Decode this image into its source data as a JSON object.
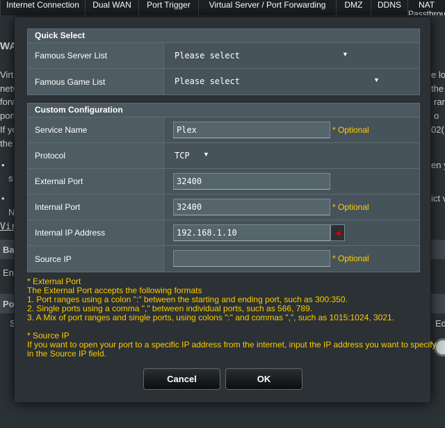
{
  "background": {
    "tabs": [
      "Internet Connection",
      "Dual WAN",
      "Port Trigger",
      "Virtual Server / Port Forwarding",
      "DMZ",
      "DDNS",
      "NAT Passthrough"
    ],
    "fragments": {
      "wa": "WA",
      "virt": "Virt",
      "netw": "netw",
      "forw": "forw",
      "port": "port",
      "if_you": "If yo",
      "the": "the",
      "bullet1": "•",
      "s1": "s",
      "bullet2": "•",
      "n1": "N",
      "vir": "Vir",
      "ba": "Ba",
      "en": "En",
      "po": "Po",
      "s2": "S",
      "r_lo": "e lo",
      "r_the": "the p",
      "r_rar": "rar",
      "r_o": "o",
      "r_02": "02(",
      "r_en": "en y",
      "r_ict": "ict v",
      "r_ed": "Ed"
    }
  },
  "quick_select": {
    "header": "Quick Select",
    "rows": [
      {
        "label": "Famous Server List",
        "value": "Please select"
      },
      {
        "label": "Famous Game List",
        "value": "Please select"
      }
    ]
  },
  "custom": {
    "header": "Custom Configuration",
    "service_name": {
      "label": "Service Name",
      "value": "Plex",
      "hint": "* Optional"
    },
    "protocol": {
      "label": "Protocol",
      "value": "TCP"
    },
    "external_port": {
      "label": "External Port",
      "value": "32400"
    },
    "internal_port": {
      "label": "Internal Port",
      "value": "32400",
      "hint": "* Optional"
    },
    "internal_ip": {
      "label": "Internal IP Address",
      "value": "192.168.1.10"
    },
    "source_ip": {
      "label": "Source IP",
      "value": "",
      "hint": "* Optional"
    }
  },
  "notes": {
    "ext_title": "* External Port",
    "ext_lines": [
      "The External Port accepts the following formats",
      "1. Port ranges using a colon \":\" between the starting and ending port, such as 300:350.",
      "2. Single ports using a comma \",\" between individual ports, such as 566, 789.",
      "3. A Mix of port ranges and single ports, using colons \":\" and commas \",\", such as 1015:1024, 3021."
    ],
    "src_title": "* Source IP",
    "src_lines": [
      "If you want to open your port to a specific IP address from the internet, input the IP address you want to specify",
      "in the Source IP field."
    ]
  },
  "buttons": {
    "cancel": "Cancel",
    "ok": "OK"
  },
  "icons": {
    "dropdown": "▼",
    "ip_picker": "left-arrow-icon"
  },
  "colors": {
    "accent_note": "#ffcc00",
    "ip_arrow": "#d00000"
  }
}
